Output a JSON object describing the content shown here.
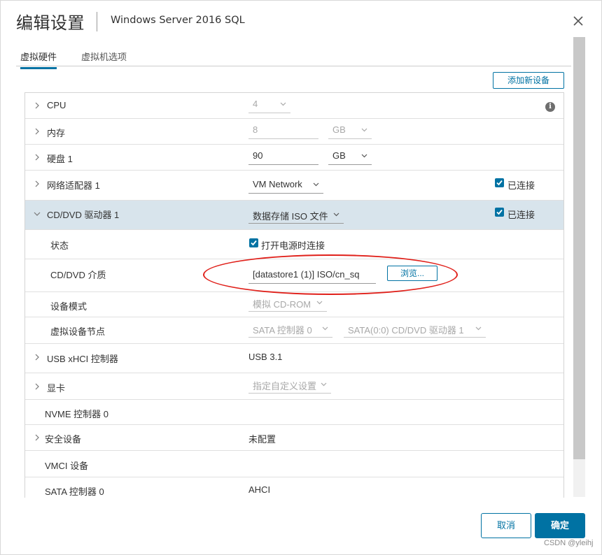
{
  "dialog": {
    "title": "编辑设置",
    "subtitle": "Windows Server 2016 SQL",
    "close_icon": "close-icon"
  },
  "tabs": [
    {
      "label": "虚拟硬件",
      "active": true
    },
    {
      "label": "虚拟机选项",
      "active": false
    }
  ],
  "toolbar": {
    "add_device_label": "添加新设备"
  },
  "rows": {
    "cpu": {
      "label": "CPU",
      "value": "4"
    },
    "memory": {
      "label": "内存",
      "value": "8",
      "unit": "GB"
    },
    "disk": {
      "label": "硬盘 1",
      "value": "90",
      "unit": "GB"
    },
    "network": {
      "label": "网络适配器 1",
      "value": "VM Network",
      "connected_label": "已连接"
    },
    "cddvd": {
      "label": "CD/DVD 驱动器 1",
      "value": "数据存储 ISO 文件",
      "connected_label": "已连接"
    },
    "status": {
      "label": "状态",
      "checkbox_label": "打开电源时连接"
    },
    "media": {
      "label": "CD/DVD 介质",
      "value": "[datastore1 (1)] ISO/cn_sq",
      "browse_label": "浏览..."
    },
    "device_mode": {
      "label": "设备模式",
      "value": "模拟 CD-ROM"
    },
    "device_node": {
      "label": "虚拟设备节点",
      "controller": "SATA 控制器 0",
      "node": "SATA(0:0) CD/DVD 驱动器 1"
    },
    "usb": {
      "label": "USB xHCI 控制器",
      "value": "USB 3.1"
    },
    "video": {
      "label": "显卡",
      "value": "指定自定义设置"
    },
    "nvme": {
      "label": "NVME 控制器 0"
    },
    "security": {
      "label": "安全设备",
      "value": "未配置"
    },
    "vmci": {
      "label": "VMCI 设备"
    },
    "sata": {
      "label": "SATA 控制器 0",
      "value": "AHCI"
    }
  },
  "footer": {
    "cancel_label": "取消",
    "ok_label": "确定"
  },
  "watermark": "CSDN @yleihj",
  "colors": {
    "accent": "#0072a3",
    "highlight_row": "#d8e4ec",
    "annotation": "#e0201a"
  }
}
